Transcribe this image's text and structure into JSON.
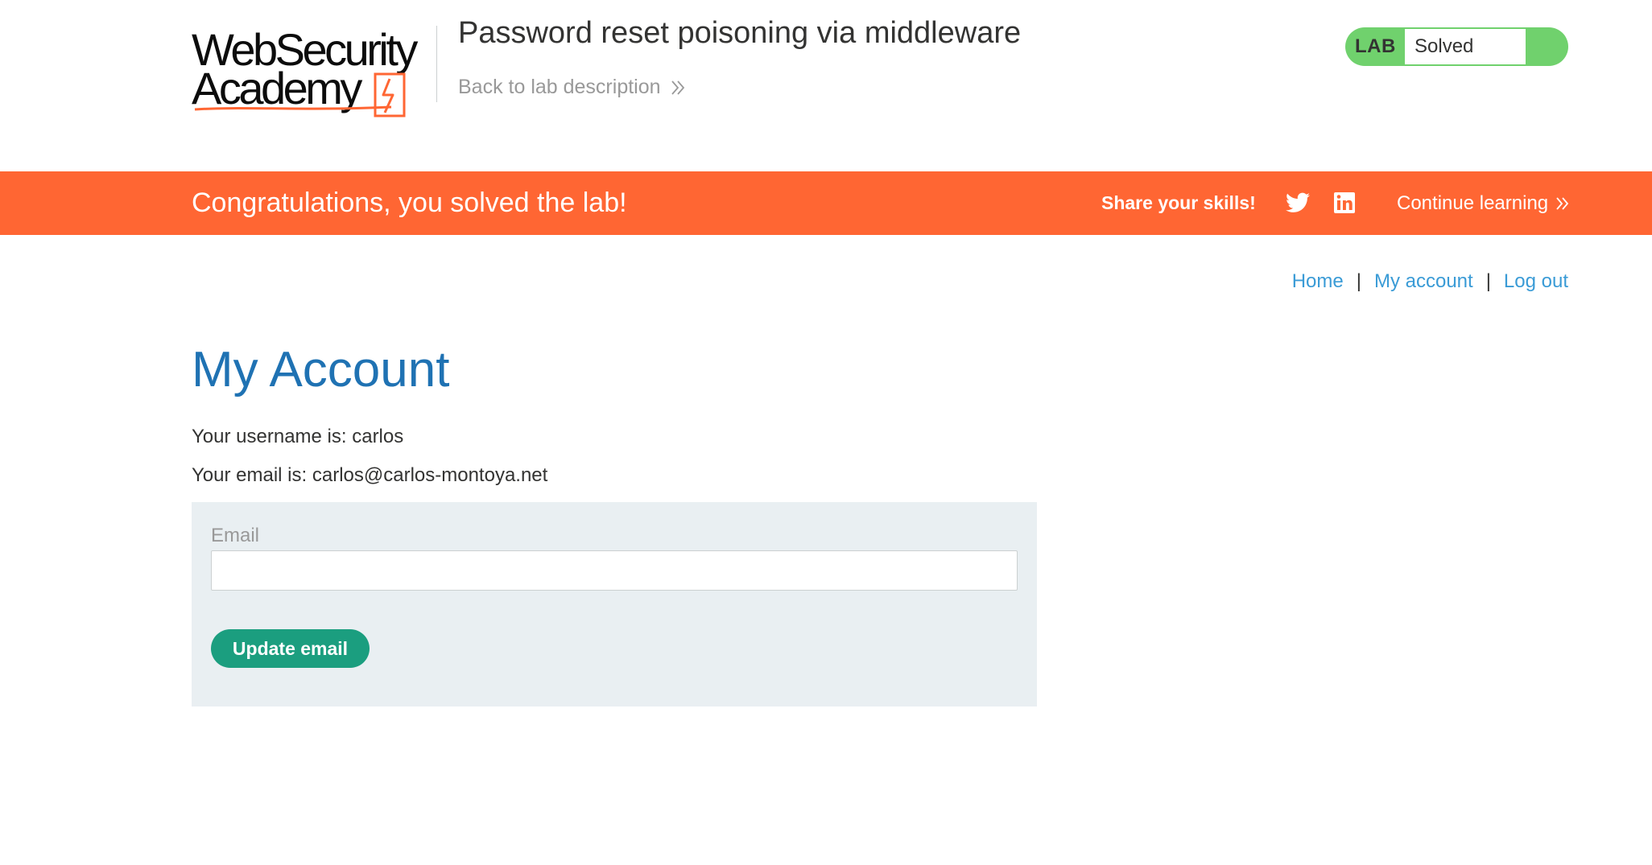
{
  "header": {
    "logo_line1": "WebSecurity",
    "logo_line2": "Academy",
    "lab_title": "Password reset poisoning via middleware",
    "back_link": "Back to lab description"
  },
  "status": {
    "tag": "LAB",
    "text": "Solved",
    "color": "#70d16d"
  },
  "banner": {
    "message": "Congratulations, you solved the lab!",
    "share_label": "Share your skills!",
    "icons": [
      "twitter-icon",
      "linkedin-icon"
    ],
    "continue_label": "Continue learning",
    "color": "#ff6633"
  },
  "nav": {
    "home": "Home",
    "my_account": "My account",
    "log_out": "Log out",
    "separator": "|"
  },
  "account": {
    "heading": "My Account",
    "username_line": "Your username is: carlos",
    "email_line": "Your email is: carlos@carlos-montoya.net"
  },
  "form": {
    "email_label": "Email",
    "email_value": "",
    "submit_label": "Update email",
    "button_color": "#1b9e7f"
  }
}
